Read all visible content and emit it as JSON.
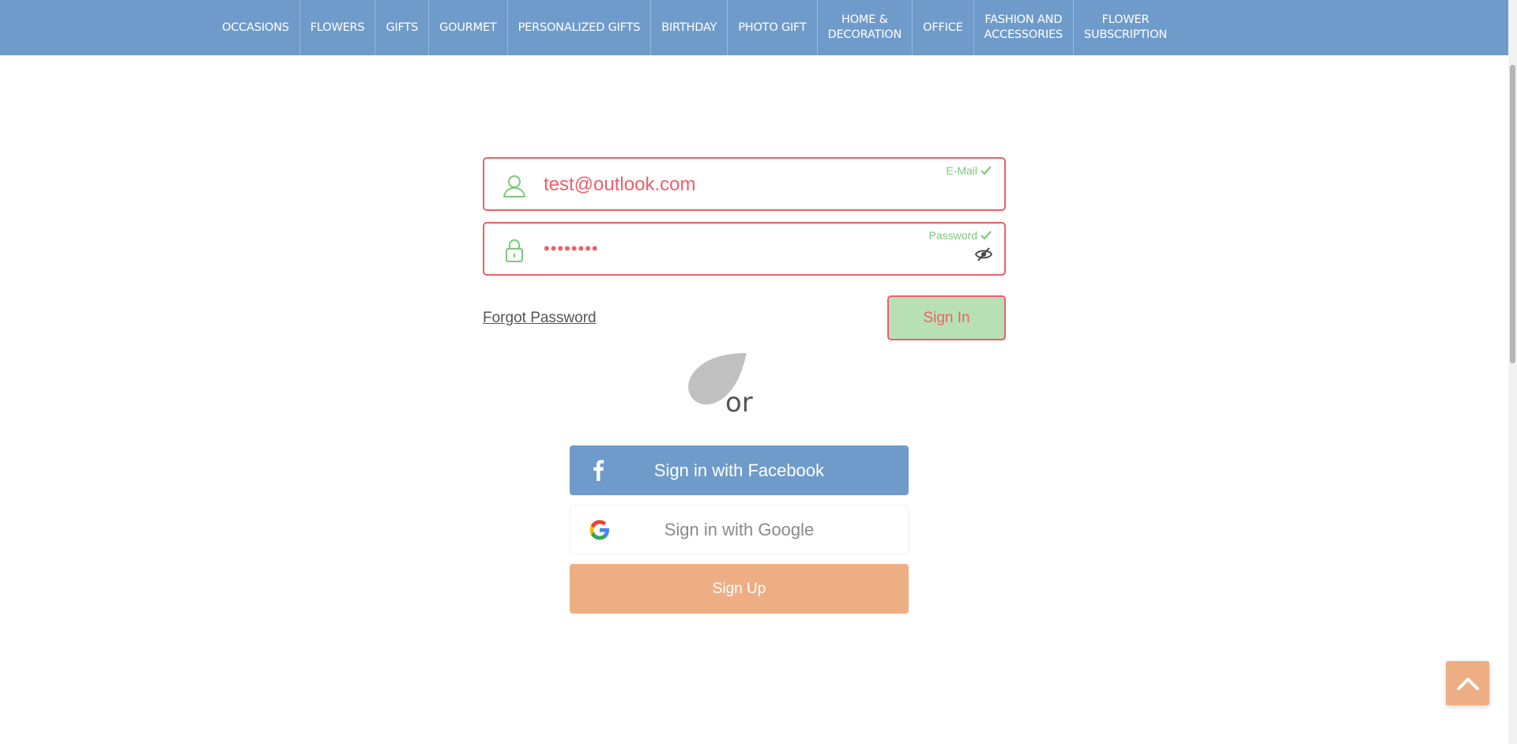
{
  "nav": {
    "items": [
      {
        "label": "OCCASIONS"
      },
      {
        "label": "FLOWERS"
      },
      {
        "label": "GIFTS"
      },
      {
        "label": "GOURMET"
      },
      {
        "label": "PERSONALIZED GIFTS"
      },
      {
        "label": "BIRTHDAY"
      },
      {
        "label": "PHOTO GIFT"
      },
      {
        "label": "HOME &\nDECORATION"
      },
      {
        "label": "OFFICE"
      },
      {
        "label": "FASHION AND\nACCESSORIES"
      },
      {
        "label": "FLOWER\nSUBSCRIPTION"
      }
    ]
  },
  "form": {
    "email": {
      "value": "test@outlook.com",
      "tag": "E-Mail",
      "icon": "user-icon"
    },
    "password": {
      "value": "••••••••",
      "tag": "Password",
      "icon": "lock-icon"
    },
    "forgot_label": "Forgot Password",
    "signin_label": "Sign In"
  },
  "divider": {
    "or_label": "or"
  },
  "social": {
    "facebook_label": "Sign in with Facebook",
    "google_label": "Sign in with Google",
    "signup_label": "Sign Up"
  },
  "colors": {
    "nav_bg": "#6f9bca",
    "error_border": "#ee5f68",
    "valid_green": "#7dc87e",
    "signup_orange": "#eeae84",
    "facebook_blue": "#6f9bca"
  }
}
